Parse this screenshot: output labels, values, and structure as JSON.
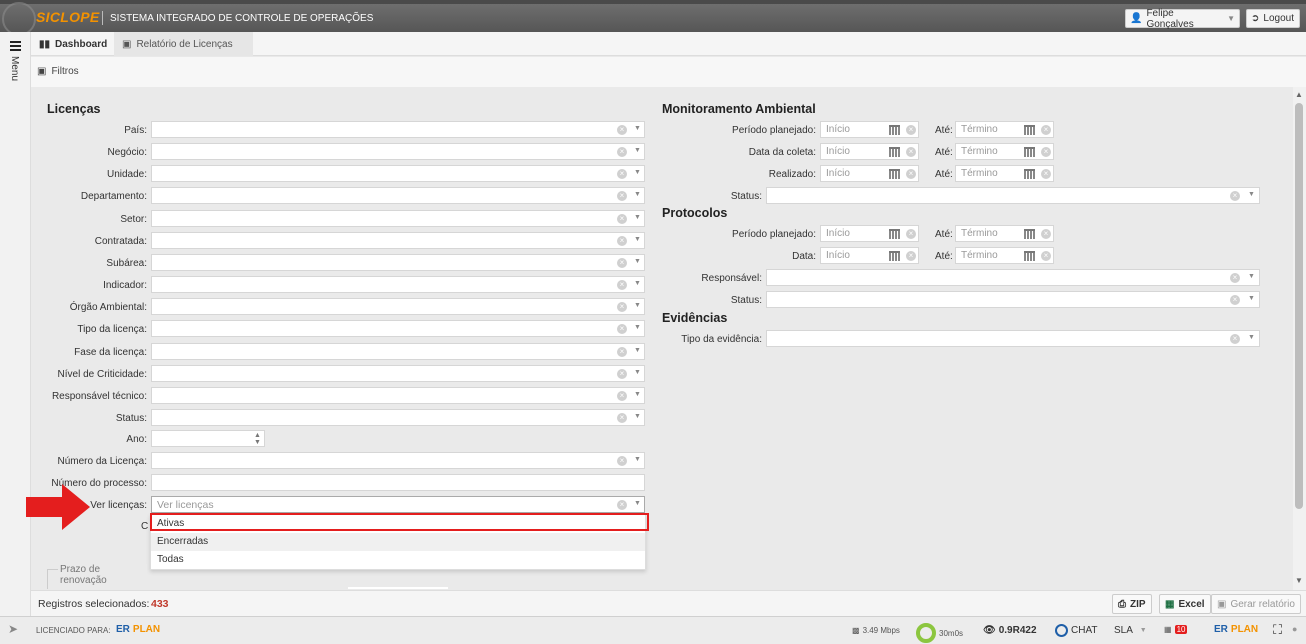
{
  "header": {
    "brand": "SICLOPE",
    "system_name": "SISTEMA INTEGRADO DE CONTROLE DE OPERAÇÕES",
    "user_name": "Felipe Gonçalves",
    "logout_label": "Logout"
  },
  "sidebar": {
    "menu_label": "Menu"
  },
  "tabs": [
    {
      "label": "Dashboard"
    },
    {
      "label": "Relatório de Licenças"
    }
  ],
  "filters_label": "Filtros",
  "licencas": {
    "title": "Licenças",
    "fields": [
      "País:",
      "Negócio:",
      "Unidade:",
      "Departamento:",
      "Setor:",
      "Contratada:",
      "Subárea:",
      "Indicador:",
      "Órgão Ambiental:",
      "Tipo da licença:",
      "Fase da licença:",
      "Nível de Criticidade:",
      "Responsável técnico:",
      "Status:"
    ],
    "ano_label": "Ano:",
    "numero_licenca_label": "Número da Licença:",
    "numero_processo_label": "Número do processo:",
    "ver_licencas_label": "Ver licenças:",
    "ver_licencas_placeholder": "Ver licenças",
    "ver_licencas_options": [
      "Ativas",
      "Encerradas",
      "Todas"
    ],
    "hidden_label_fragment": "C",
    "prazo_label": "Prazo de renovação"
  },
  "monitoramento": {
    "title": "Monitoramento Ambiental",
    "date_rows": [
      {
        "label": "Período planejado:",
        "start_ph": "Início",
        "end_label": "Até:",
        "end_ph": "Término"
      },
      {
        "label": "Data da coleta:",
        "start_ph": "Início",
        "end_label": "Até:",
        "end_ph": "Término"
      },
      {
        "label": "Realizado:",
        "start_ph": "Início",
        "end_label": "Até:",
        "end_ph": "Término"
      }
    ],
    "status_label": "Status:"
  },
  "protocolos": {
    "title": "Protocolos",
    "date_rows": [
      {
        "label": "Período planejado:",
        "start_ph": "Início",
        "end_label": "Até:",
        "end_ph": "Término"
      },
      {
        "label": "Data:",
        "start_ph": "Início",
        "end_label": "Até:",
        "end_ph": "Término"
      }
    ],
    "responsavel_label": "Responsável:",
    "status_label": "Status:"
  },
  "evidencias": {
    "title": "Evidências",
    "tipo_label": "Tipo da evidência:"
  },
  "footer": {
    "registros_label": "Registros selecionados:",
    "registros_count": "433",
    "zip_label": "ZIP",
    "excel_label": "Excel",
    "gerar_label": "Gerar relatório"
  },
  "statusbar": {
    "licenciado_label": "LICENCIADO PARA:",
    "erplan_left": "ER",
    "erplan_right": "PLAN",
    "speed": "3.49 Mbps",
    "time": "30m0s",
    "version": "0.9R422",
    "chat": "CHAT",
    "sla": "SLA",
    "badge": "10"
  },
  "colors": {
    "accent": "#f39200",
    "highlight": "#e41e1e",
    "count": "#c0392b"
  }
}
